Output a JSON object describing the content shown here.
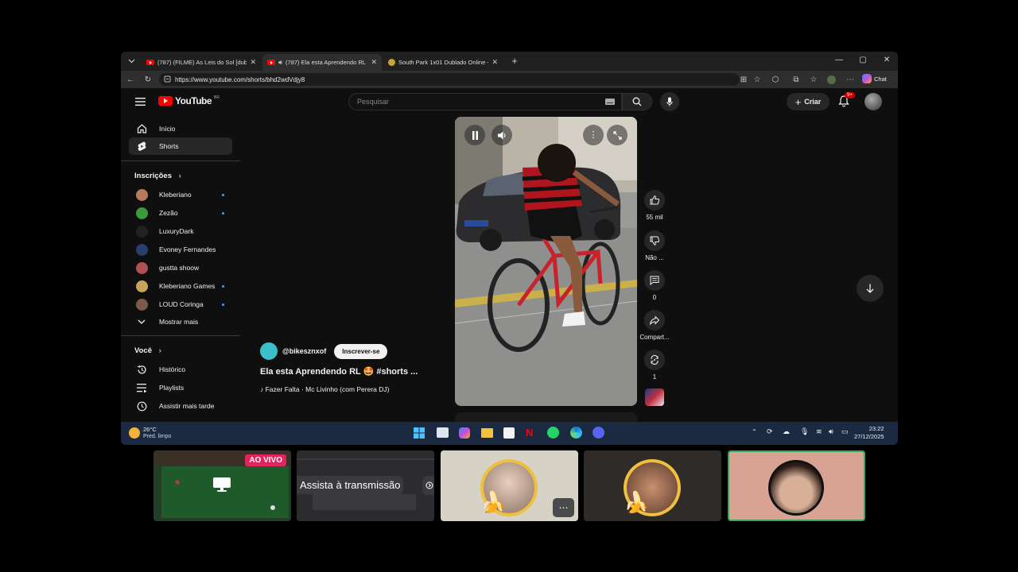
{
  "browser": {
    "tabs": [
      {
        "title": "(787) (FILME) As Leis do Sol [dublado",
        "favicon": "youtube-icon"
      },
      {
        "title": "(787) Ela esta Aprendendo RL",
        "favicon": "youtube-icon",
        "audio": true
      },
      {
        "title": "South Park 1x01 Dublado Online -",
        "favicon": "southpark-icon"
      }
    ],
    "url": "https://www.youtube.com/shorts/bhd2wdVdjy8",
    "chat_label": "Chat"
  },
  "youtube": {
    "logo_text": "YouTube",
    "logo_region": "BR",
    "search_placeholder": "Pesquisar",
    "create_label": "Criar",
    "notifications_badge": "9+",
    "sidebar": {
      "main": [
        {
          "label": "Início",
          "icon": "home-icon"
        },
        {
          "label": "Shorts",
          "icon": "shorts-icon",
          "active": true
        }
      ],
      "subscriptions_heading": "Inscrições",
      "subscriptions": [
        {
          "label": "Kleberiano",
          "new": true,
          "color": "#b87a5e"
        },
        {
          "label": "Zezão",
          "new": true,
          "color": "#3a9b3a"
        },
        {
          "label": "LuxuryDark",
          "new": false,
          "color": "#222222"
        },
        {
          "label": "Evoney Fernandes",
          "new": false,
          "color": "#2a3f6e"
        },
        {
          "label": "gustta shoow",
          "new": false,
          "color": "#b05050"
        },
        {
          "label": "Kleberiano Games",
          "new": true,
          "color": "#c9a35a"
        },
        {
          "label": "LOUD Coringa",
          "new": true,
          "color": "#7a5a4a"
        }
      ],
      "show_more": "Mostrar mais",
      "you_heading": "Você",
      "you": [
        {
          "label": "Histórico",
          "icon": "history-icon"
        },
        {
          "label": "Playlists",
          "icon": "playlists-icon"
        },
        {
          "label": "Assistir mais tarde",
          "icon": "watch-later-icon"
        }
      ]
    },
    "short": {
      "channel": "@bikesznxof",
      "subscribe_label": "Inscrever-se",
      "title": "Ela esta Aprendendo RL 🤩 #shorts ...",
      "music": "♪ Fazer Falta · Mc Livinho (com Perera DJ)",
      "likes": "55 mil",
      "dislike_label": "Não ...",
      "comments": "0",
      "share_label": "Compart...",
      "remix_count": "1"
    }
  },
  "taskbar": {
    "temperature": "26°C",
    "weather": "Pred. limpo",
    "time": "23:22",
    "date": "27/12/2025"
  },
  "call": {
    "live_badge": "AO VIVO",
    "watch_stream_label": "Assista à transmissão"
  }
}
